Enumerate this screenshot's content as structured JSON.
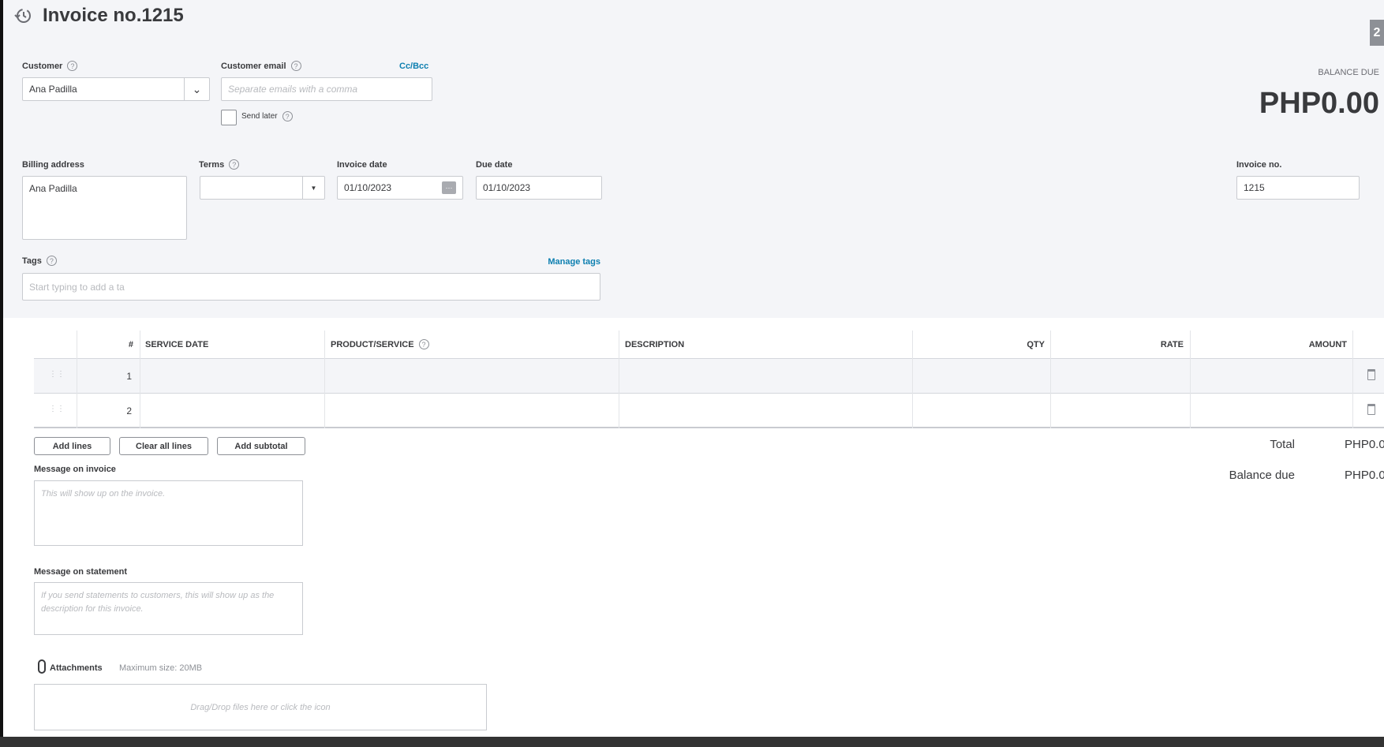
{
  "header": {
    "title": "Invoice no.1215",
    "badge": "2"
  },
  "customer": {
    "label": "Customer",
    "value": "Ana Padilla"
  },
  "email": {
    "label": "Customer email",
    "placeholder": "Separate emails with a comma",
    "cc_bcc": "Cc/Bcc",
    "send_later": "Send later"
  },
  "balance": {
    "label": "BALANCE DUE",
    "amount": "PHP0.00"
  },
  "billing": {
    "label": "Billing address",
    "value": "Ana Padilla"
  },
  "terms": {
    "label": "Terms",
    "value": ""
  },
  "invoice_date": {
    "label": "Invoice date",
    "value": "01/10/2023"
  },
  "due_date": {
    "label": "Due date",
    "value": "01/10/2023"
  },
  "invoice_no": {
    "label": "Invoice no.",
    "value": "1215"
  },
  "tags": {
    "label": "Tags",
    "manage": "Manage tags",
    "placeholder": "Start typing to add a ta"
  },
  "table": {
    "columns": {
      "num": "#",
      "service_date": "SERVICE DATE",
      "product": "PRODUCT/SERVICE",
      "description": "DESCRIPTION",
      "qty": "QTY",
      "rate": "RATE",
      "amount": "AMOUNT"
    },
    "rows": [
      {
        "num": "1"
      },
      {
        "num": "2"
      }
    ]
  },
  "buttons": {
    "add_lines": "Add lines",
    "clear_all": "Clear all lines",
    "add_subtotal": "Add subtotal"
  },
  "totals": {
    "total_label": "Total",
    "total_value": "PHP0.0",
    "balance_label": "Balance due",
    "balance_value": "PHP0.0"
  },
  "message_invoice": {
    "label": "Message on invoice",
    "placeholder": "This will show up on the invoice."
  },
  "message_statement": {
    "label": "Message on statement",
    "placeholder": "If you send statements to customers, this will show up as the description for this invoice."
  },
  "attachments": {
    "label": "Attachments",
    "max": "Maximum size: 20MB",
    "drop": "Drag/Drop files here or click the icon"
  }
}
